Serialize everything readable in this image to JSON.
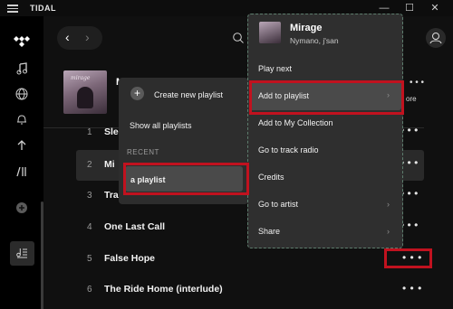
{
  "app": {
    "title": "TIDAL"
  },
  "window_controls": {
    "minimize": "—",
    "maximize": "☐",
    "close": "✕"
  },
  "album": {
    "title_partial": "M",
    "art_text": "mirage",
    "more_text": "ore"
  },
  "tracks": [
    {
      "num": "1",
      "name": "Slee"
    },
    {
      "num": "2",
      "name": "Mi"
    },
    {
      "num": "3",
      "name": "Train Ride"
    },
    {
      "num": "4",
      "name": "One Last Call"
    },
    {
      "num": "5",
      "name": "False Hope"
    },
    {
      "num": "6",
      "name": "The Ride Home (interlude)"
    }
  ],
  "more_glyph": "• • •",
  "playlist_menu": {
    "create": "Create new playlist",
    "show_all": "Show all playlists",
    "recent_label": "RECENT",
    "recent_items": [
      "a playlist"
    ]
  },
  "context_menu": {
    "track_title": "Mirage",
    "track_artists": "Nymano, j'san",
    "items": [
      "Play next",
      "Add to playlist",
      "Add to My Collection",
      "Go to track radio",
      "Credits",
      "Go to artist",
      "Share"
    ],
    "chevron": "›"
  },
  "colors": {
    "annotation": "#c1121f",
    "menu_bg": "#2f2f2f",
    "selected_row": "#2a2a2a"
  }
}
